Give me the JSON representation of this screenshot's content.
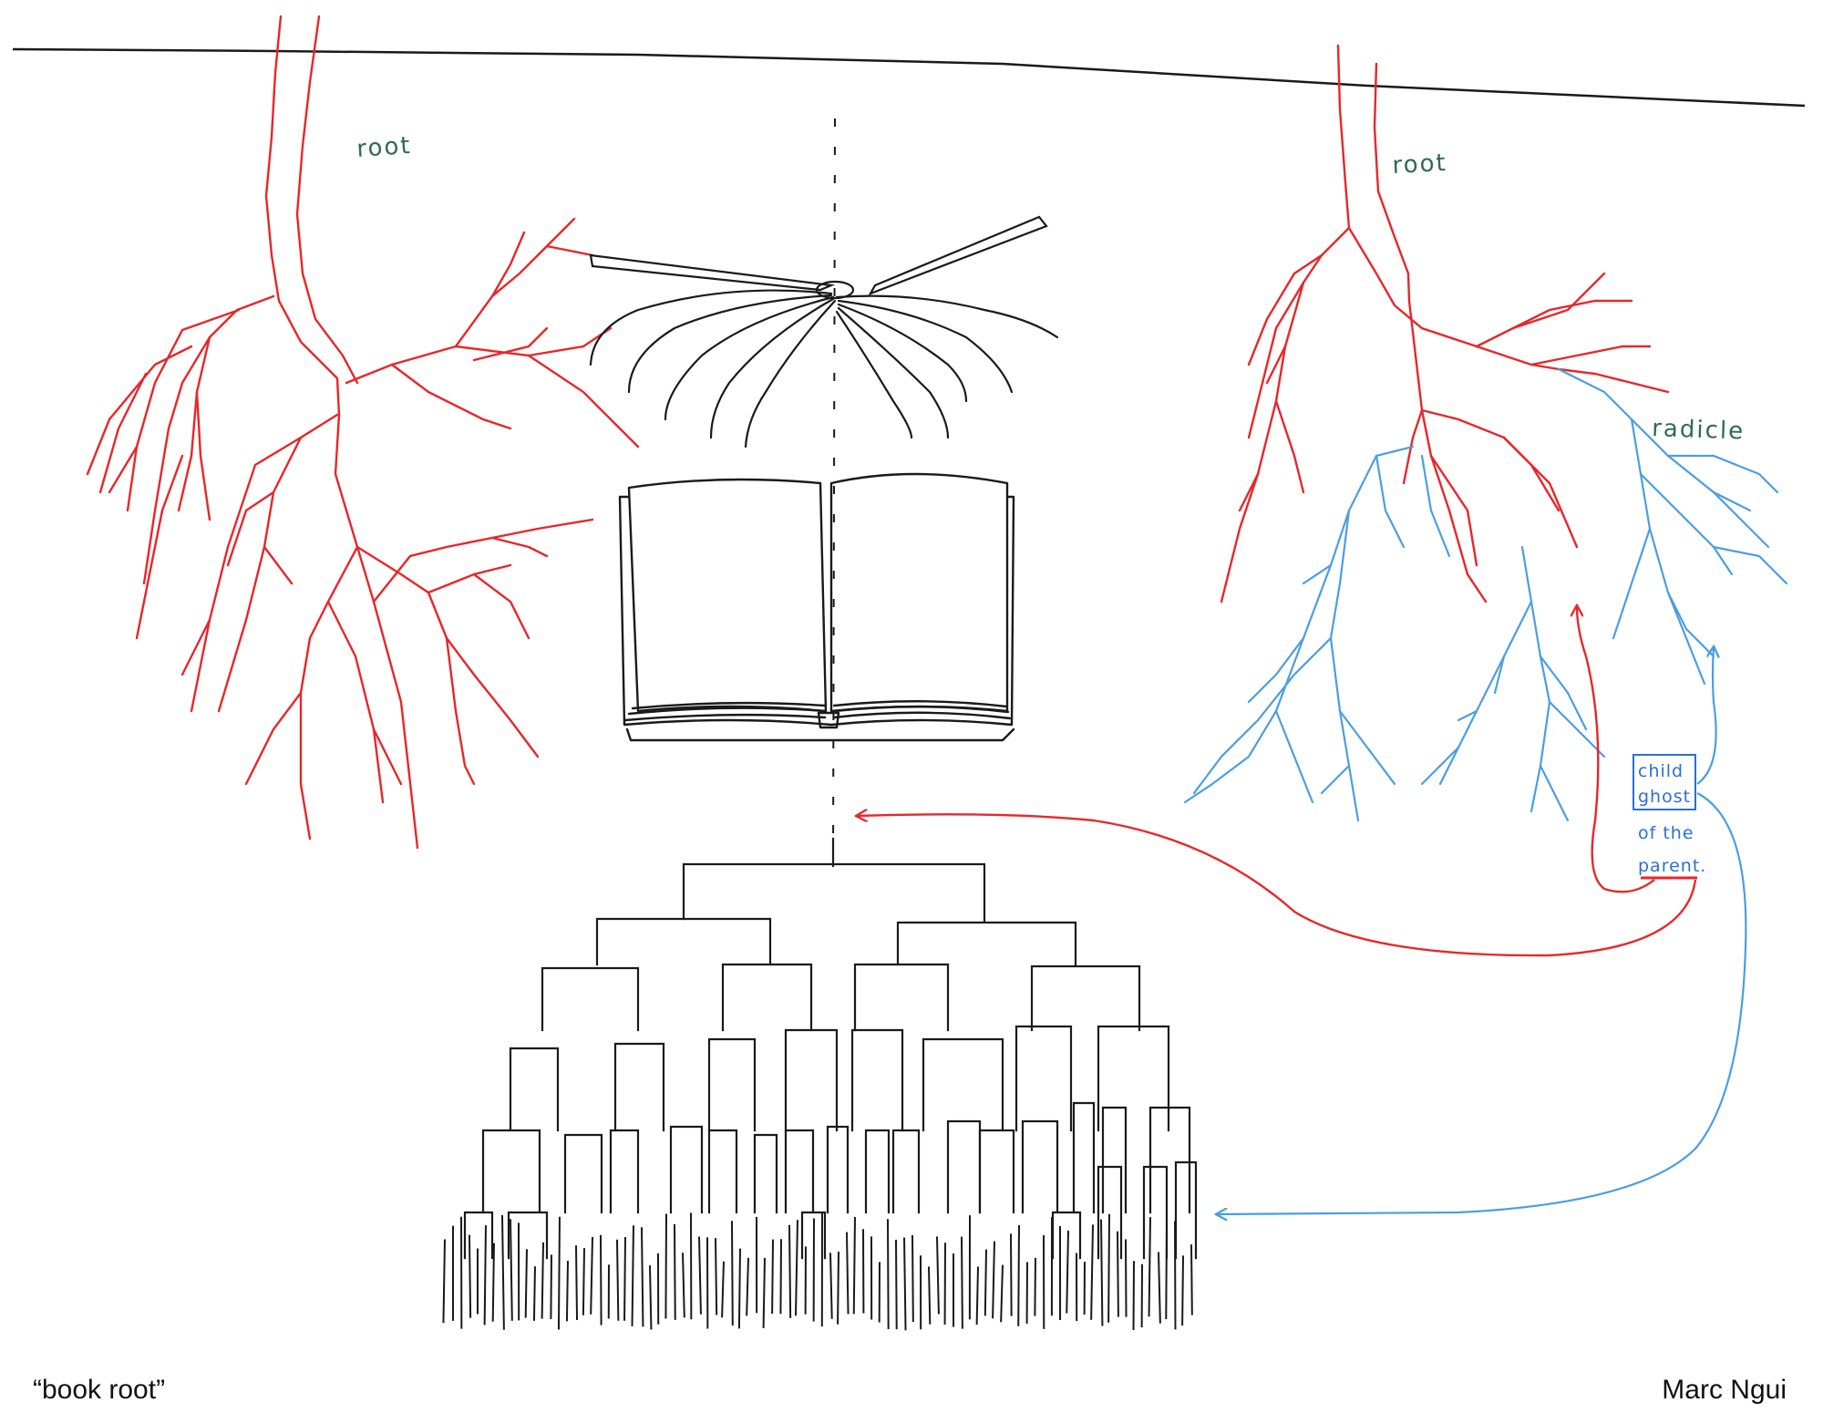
{
  "colors": {
    "ink": "#1a1a1a",
    "root": "#e8262a",
    "radicle": "#4a9ee0",
    "label_green": "#2f6b50",
    "label_blue": "#2a6fd6"
  },
  "labels": {
    "root_left": "root",
    "root_right": "root",
    "radicle": "radicle",
    "child_ghost_lines": [
      "child",
      "ghost",
      "of the",
      "parent."
    ]
  },
  "caption": {
    "title": "“book root”",
    "author": "Marc Ngui"
  },
  "icons": {
    "left_root": "branching-root-icon",
    "right_root": "branching-root-icon",
    "radicle": "branching-radicle-icon",
    "open_book": "open-book-icon",
    "fanned_book": "fanned-book-icon",
    "dendrogram": "binary-tree-icon"
  }
}
